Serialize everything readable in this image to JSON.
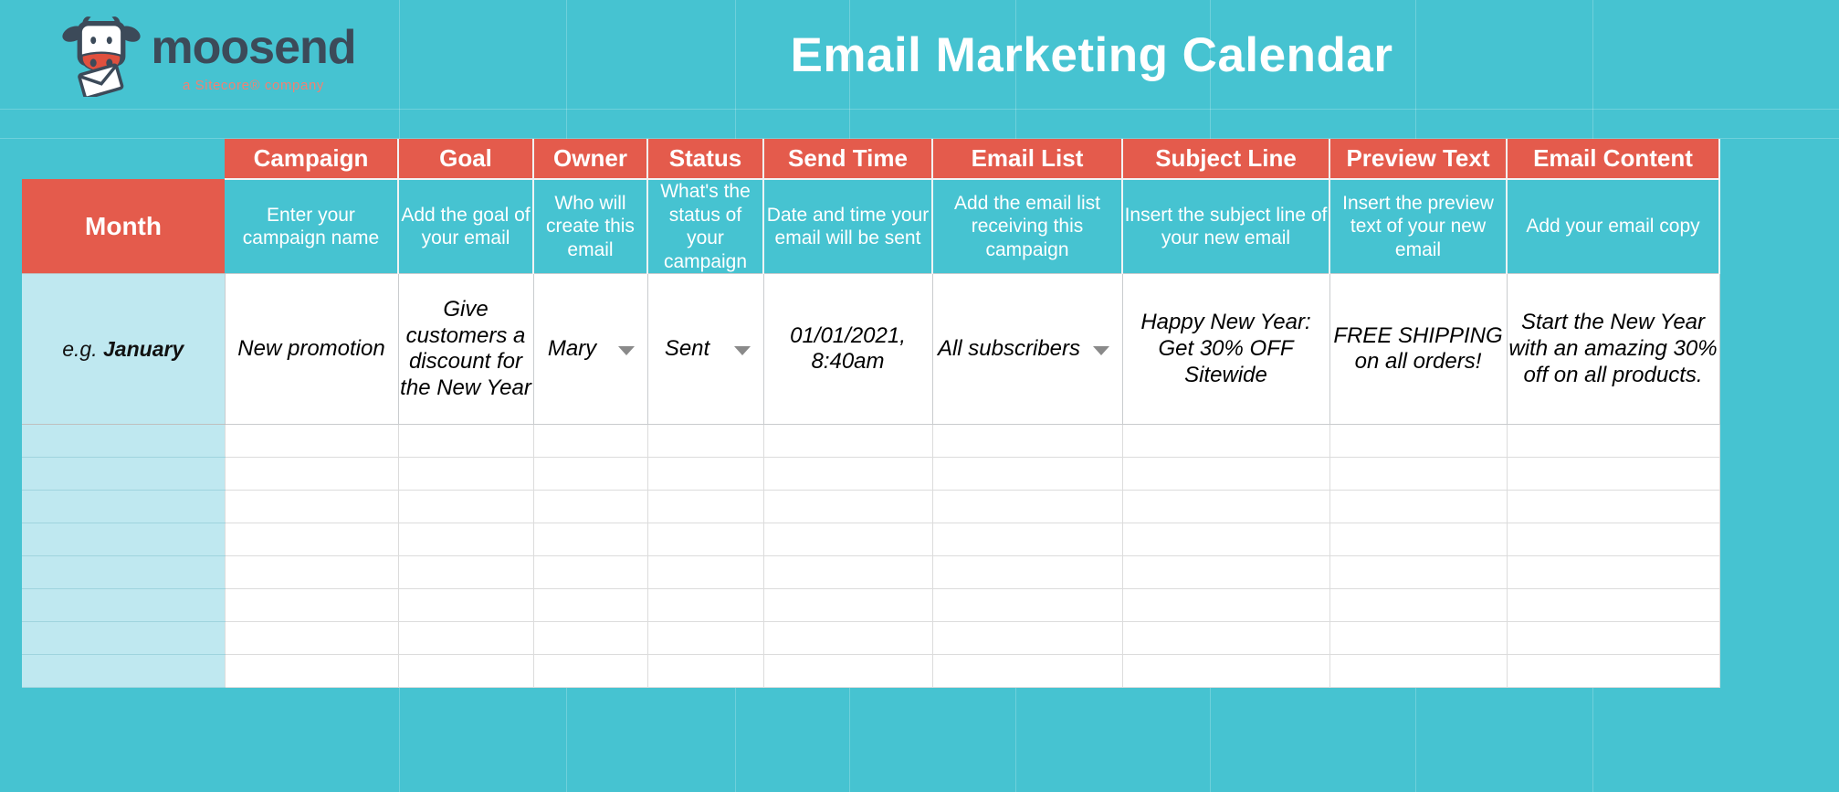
{
  "brand": {
    "logo_word": "moosend",
    "logo_tagline": "a Sitecore® company",
    "logo_icon": "cow-mascot-icon"
  },
  "header": {
    "title": "Email Marketing Calendar"
  },
  "colors": {
    "teal": "#46C3D1",
    "red": "#E45B4C",
    "light_blue": "#BFE8F0",
    "white": "#FFFFFF",
    "logo_navy": "#3C4A59"
  },
  "table": {
    "month_label": "Month",
    "columns": [
      {
        "header": "Campaign",
        "instruction": "Enter your campaign name"
      },
      {
        "header": "Goal",
        "instruction": "Add the goal of your email"
      },
      {
        "header": "Owner",
        "instruction": "Who will create this email"
      },
      {
        "header": "Status",
        "instruction": "What's the status of your campaign"
      },
      {
        "header": "Send Time",
        "instruction": "Date and time your email will be sent"
      },
      {
        "header": "Email List",
        "instruction": "Add the email list receiving this campaign"
      },
      {
        "header": "Subject Line",
        "instruction": "Insert the subject line of your new email"
      },
      {
        "header": "Preview Text",
        "instruction": "Insert the preview text of your new email"
      },
      {
        "header": "Email Content",
        "instruction": "Add your email copy"
      }
    ],
    "example_row": {
      "month_prefix": "e.g. ",
      "month_value": "January",
      "campaign": "New promotion",
      "goal": "Give customers a discount for the New Year",
      "owner": "Mary",
      "status": "Sent",
      "send_time": "01/01/2021, 8:40am",
      "email_list": "All subscribers",
      "subject_line": "Happy New Year: Get 30% OFF Sitewide",
      "preview_text": "FREE SHIPPING on all orders!",
      "email_content": "Start the New Year with an amazing 30% off on all products."
    },
    "empty_row_count": 8,
    "dropdown_columns": [
      "Owner",
      "Status",
      "Email List"
    ],
    "dropdown_icon": "chevron-down-icon"
  }
}
